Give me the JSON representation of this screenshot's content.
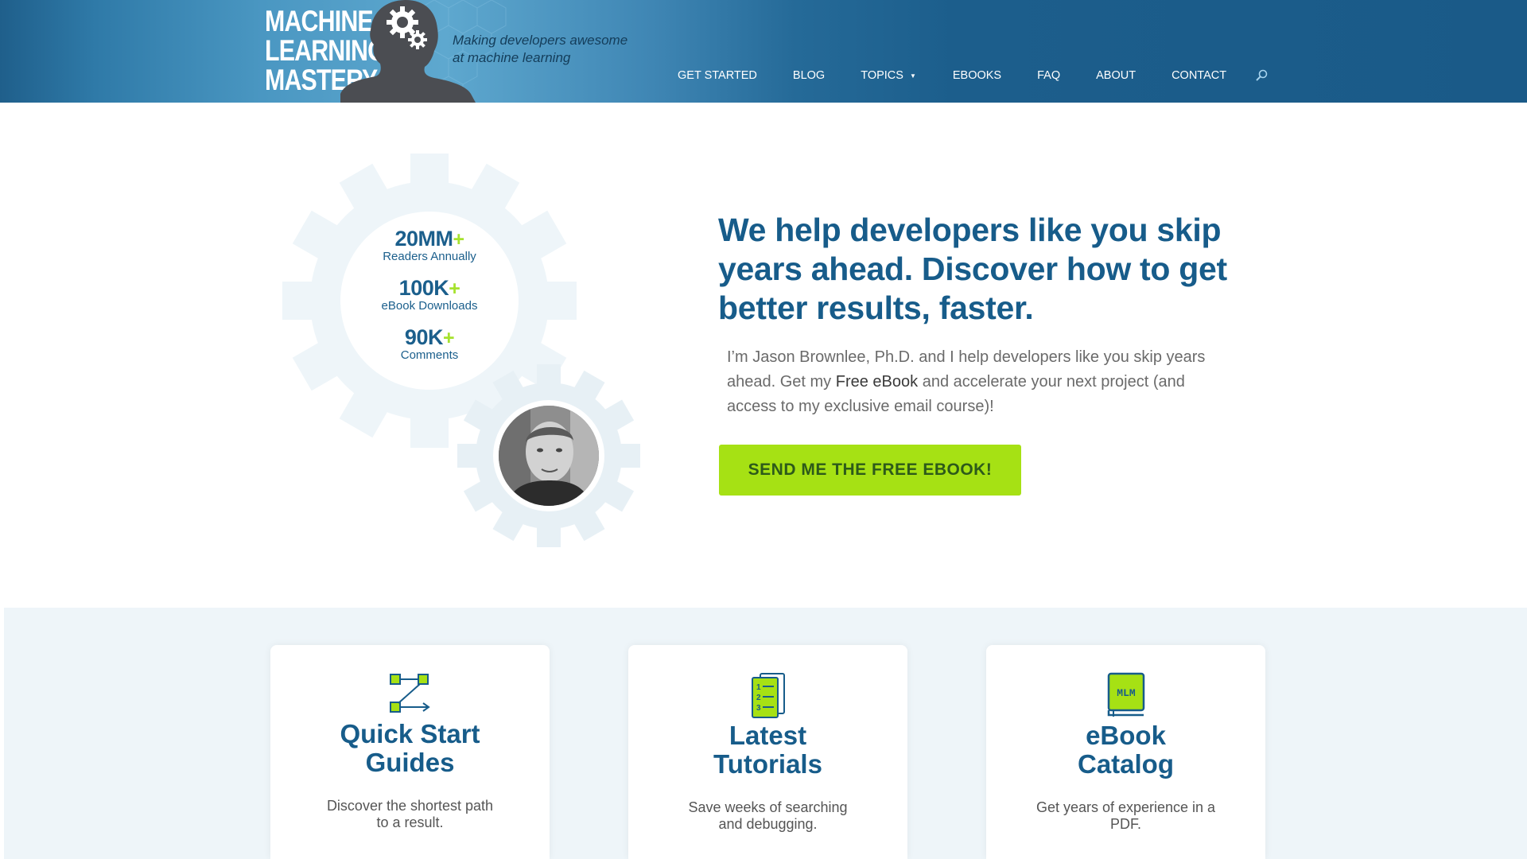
{
  "header": {
    "logo_lines": [
      "MACHINE",
      "LEARNING",
      "MASTERY"
    ],
    "tagline_line1": "Making developers awesome",
    "tagline_line2": "at machine learning",
    "nav": {
      "get_started": "GET STARTED",
      "blog": "BLOG",
      "topics": "TOPICS",
      "ebooks": "EBOOKS",
      "faq": "FAQ",
      "about": "ABOUT",
      "contact": "CONTACT"
    }
  },
  "stats": [
    {
      "number": "20MM",
      "plus": "+",
      "label": "Readers Annually"
    },
    {
      "number": "100K",
      "plus": "+",
      "label": "eBook Downloads"
    },
    {
      "number": "90K",
      "plus": "+",
      "label": "Comments"
    }
  ],
  "hero": {
    "title": "We help developers like you skip years ahead. Discover how to get better results, faster.",
    "desc_before": "I’m Jason Brownlee, Ph.D. and I help developers like you skip years ahead. Get my ",
    "desc_link": "Free eBook",
    "desc_after": " and accelerate your next project (and access to my exclusive email course)!",
    "cta": "SEND ME THE FREE EBOOK!"
  },
  "cards": [
    {
      "title_line1": "Quick Start",
      "title_line2": "Guides",
      "desc_line1": "Discover the shortest path",
      "desc_line2": "to a result.",
      "icon": "path-icon"
    },
    {
      "title_line1": "Latest",
      "title_line2": "Tutorials",
      "desc_line1": "Save weeks of searching",
      "desc_line2": "and debugging.",
      "icon": "numbered-list-icon"
    },
    {
      "title_line1": "eBook",
      "title_line2": "Catalog",
      "desc_line1": "Get years of experience in a",
      "desc_line2": "PDF.",
      "icon": "book-icon",
      "icon_text": "MLM"
    }
  ],
  "colors": {
    "accent_green": "#a6e114",
    "brand_blue": "#175c8a",
    "header_blue": "#1f5f8b"
  }
}
